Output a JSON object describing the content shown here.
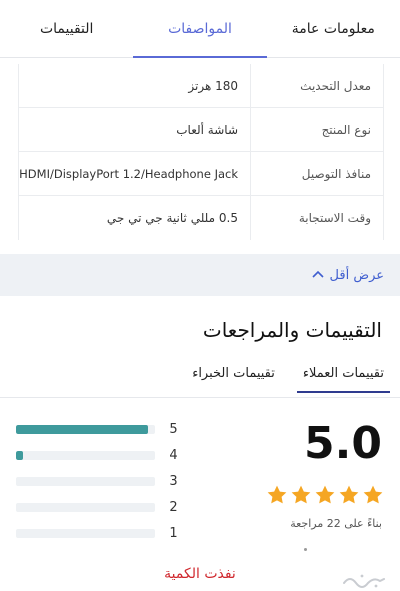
{
  "tabs": [
    {
      "label": "معلومات عامة",
      "active": false
    },
    {
      "label": "المواصفات",
      "active": true
    },
    {
      "label": "التقييمات",
      "active": false
    }
  ],
  "specs": [
    {
      "key": "معدل التحديث",
      "value": "180 هرتز"
    },
    {
      "key": "نوع المنتج",
      "value": "شاشة ألعاب"
    },
    {
      "key": "منافذ التوصيل",
      "value": "HDMI/DisplayPort 1.2/Headphone Jack"
    },
    {
      "key": "وقت الاستجابة",
      "value": "0.5 مللي ثانية جي تي جي"
    }
  ],
  "show_less": {
    "label": "عرض أقل"
  },
  "reviews": {
    "title": "التقييمات والمراجعات",
    "tabs": [
      {
        "label": "تقييمات العملاء",
        "active": true
      },
      {
        "label": "تقييمات الخبراء",
        "active": false
      }
    ],
    "score": "5.0",
    "stars_filled": 5,
    "based_on": "بناءً على 22 مراجعة",
    "distribution": [
      {
        "stars": "5",
        "fraction": 0.95
      },
      {
        "stars": "4",
        "fraction": 0.05
      },
      {
        "stars": "3",
        "fraction": 0
      },
      {
        "stars": "2",
        "fraction": 0
      },
      {
        "stars": "1",
        "fraction": 0
      }
    ]
  },
  "sold_out": "نفذت الكمية",
  "colors": {
    "accent": "#5a6ad6",
    "link": "#3f5ecf",
    "star": "#f5a623",
    "bar": "#3e9a9c",
    "sold_out": "#d0282e"
  }
}
